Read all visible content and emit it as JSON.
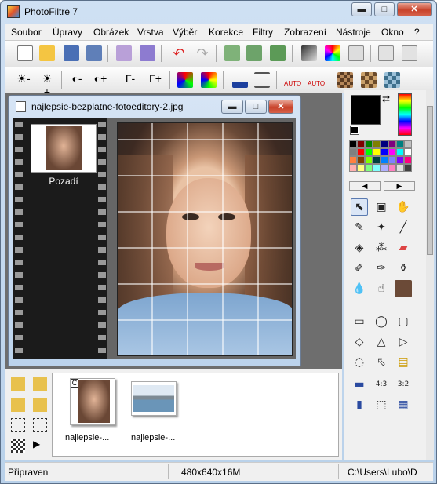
{
  "app": {
    "title": "PhotoFiltre 7"
  },
  "window_controls": {
    "minimize": "▬",
    "maximize": "□",
    "close": "✕"
  },
  "menu": [
    "Soubor",
    "Úpravy",
    "Obrázek",
    "Vrstva",
    "Výběr",
    "Korekce",
    "Filtry",
    "Zobrazení",
    "Nástroje",
    "Okno",
    "?"
  ],
  "toolbar1": {
    "icons": [
      "new-file-icon",
      "open-folder-icon",
      "save-icon",
      "save-as-icon",
      "print-icon",
      "twain-icon",
      "undo-icon",
      "redo-icon",
      "image-size-icon",
      "canvas-size-icon",
      "duplicate-icon",
      "gradient-icon",
      "colors-icon",
      "stamp-icon",
      "exit-icon",
      "run-icon"
    ]
  },
  "toolbar2": {
    "icons": [
      "brightness-minus-icon",
      "brightness-plus-icon",
      "contrast-minus-icon",
      "contrast-plus-icon",
      "gamma-minus-icon",
      "gamma-plus-icon",
      "saturation-minus-icon",
      "saturation-plus-icon",
      "histogram-icon",
      "levels-icon",
      "auto-levels-icon",
      "auto-contrast-icon",
      "pixelate-icon",
      "texture-icon",
      "sharpen-icon"
    ],
    "labels": {
      "gamma_minus": "Γ-",
      "gamma_plus": "Γ+",
      "auto1": "AUTO",
      "auto2": "AUTO"
    }
  },
  "document": {
    "title": "najlepsie-bezplatne-fotoeditory-2.jpg",
    "layer_name": "Pozadí"
  },
  "explorer": {
    "thumbnails": [
      {
        "label": "najlepsie-..."
      },
      {
        "label": "najlepsie-..."
      }
    ],
    "thumb_badge": "C"
  },
  "tools": {
    "selected": "pointer",
    "items": [
      "pointer-tool",
      "frame-tool",
      "hand-tool",
      "eyedropper-tool",
      "magic-wand-tool",
      "line-tool",
      "fill-tool",
      "spray-tool",
      "eraser-tool",
      "brush-tool",
      "advanced-brush-tool",
      "stamp-tool",
      "blur-tool",
      "smudge-tool",
      "clone-tool",
      "rectangle-shape",
      "ellipse-shape",
      "rounded-rect-shape",
      "diamond-shape",
      "triangle-shape",
      "arrow-shape",
      "lasso-shape",
      "polygon-shape",
      "open-shape",
      "select-all",
      "ratio-4-3",
      "ratio-3-2",
      "invert-select",
      "fit-select",
      "settings-select"
    ],
    "ratio_labels": {
      "a": "4:3",
      "b": "3:2"
    }
  },
  "colors": {
    "foreground": "#000000",
    "background": "#ffffff",
    "palette": [
      "#000000",
      "#7f0000",
      "#007f00",
      "#7f7f00",
      "#00007f",
      "#7f007f",
      "#007f7f",
      "#c0c0c0",
      "#808080",
      "#ff0000",
      "#00ff00",
      "#ffff00",
      "#0000ff",
      "#ff00ff",
      "#00ffff",
      "#ffffff",
      "#ff8040",
      "#804000",
      "#80ff00",
      "#004040",
      "#0080ff",
      "#8080ff",
      "#8000ff",
      "#ff0080",
      "#ffb0b0",
      "#ffff80",
      "#80ff80",
      "#80ffff",
      "#b0b0ff",
      "#ff80c0",
      "#e0e0e0",
      "#404040"
    ]
  },
  "status": {
    "state": "Připraven",
    "size": "480x640x16M",
    "path": "C:\\Users\\Lubo\\D"
  }
}
